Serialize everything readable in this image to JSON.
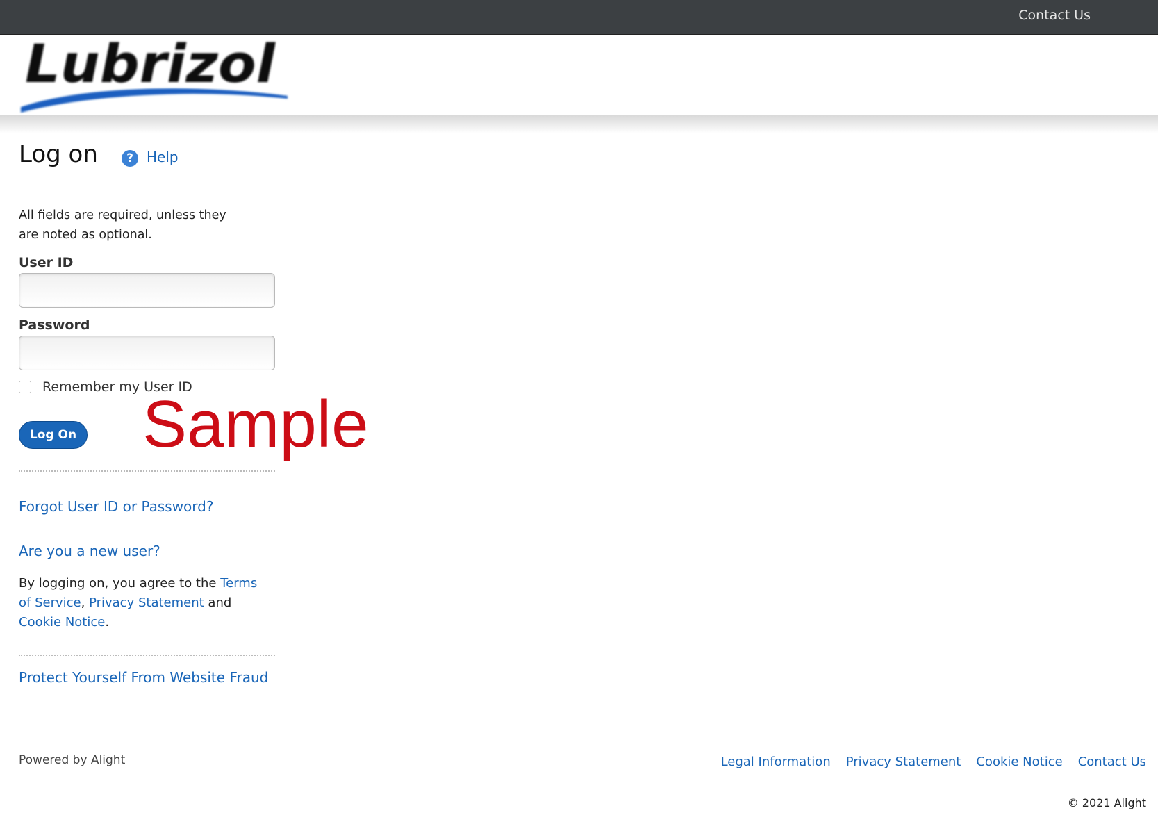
{
  "topbar": {
    "contact": "Contact Us"
  },
  "logo": {
    "text": "Lubrizol",
    "colors": {
      "text": "#111111",
      "swoosh": "#1a5fc0"
    }
  },
  "page": {
    "title": "Log on",
    "help": "Help",
    "required_note": "All fields are required, unless they are noted as optional."
  },
  "form": {
    "userid_label": "User ID",
    "userid_value": "",
    "password_label": "Password",
    "password_value": "",
    "remember_label": "Remember my User ID",
    "remember_checked": false,
    "submit_label": "Log On"
  },
  "watermark": "Sample",
  "links": {
    "forgot": "Forgot User ID or Password?",
    "new_user": "Are you a new user?",
    "fraud": "Protect Yourself From Website Fraud"
  },
  "agreement": {
    "prefix": "By logging on, you agree to the ",
    "terms": "Terms of Service",
    "comma": ", ",
    "privacy": "Privacy Statement",
    "and": " and ",
    "cookie": "Cookie Notice",
    "end": "."
  },
  "footer": {
    "powered": "Powered by Alight",
    "links": [
      "Legal Information",
      "Privacy Statement",
      "Cookie Notice",
      "Contact Us"
    ],
    "copyright": "© 2021 Alight"
  },
  "colors": {
    "topbar": "#3c4043",
    "link": "#1a66b8",
    "button": "#1a66b8",
    "watermark": "#cc0d16"
  }
}
